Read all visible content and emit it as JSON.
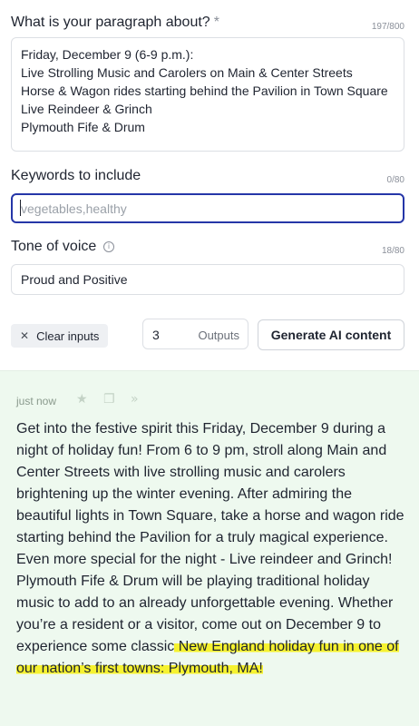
{
  "form": {
    "paragraph": {
      "label": "What is your paragraph about?",
      "required_mark": "*",
      "counter": "197/800",
      "lines": [
        "Friday, December 9 (6-9 p.m.):",
        "Live Strolling Music and Carolers on Main & Center Streets",
        "Horse & Wagon rides starting behind the Pavilion in Town Square",
        "Live Reindeer & Grinch",
        "Plymouth Fife & Drum"
      ]
    },
    "keywords": {
      "label": "Keywords to include",
      "counter": "0/80",
      "value": "",
      "placeholder": "vegetables,healthy"
    },
    "tone": {
      "label": "Tone of voice",
      "info_icon": "info-icon",
      "counter": "18/80",
      "value": "Proud and Positive"
    },
    "actions": {
      "clear_label": "Clear inputs",
      "outputs_value": "3",
      "outputs_label": "Outputs",
      "generate_label": "Generate AI content"
    }
  },
  "result": {
    "timestamp": "just now",
    "toolbar_icons": [
      "star-icon",
      "copy-icon",
      "double-chevron-right-icon"
    ],
    "text_plain": "Get into the festive spirit this Friday, December 9 during a night of holiday fun! From 6 to 9 pm, stroll along Main and Center Streets with live strolling music and carolers brightening up the winter evening. After admiring the beautiful lights in Town Square, take a horse and wagon ride starting behind the Pavilion for a truly magical experience. Even more special for the night - Live reindeer and Grinch! Plymouth Fife & Drum will be playing traditional holiday music to add to an already unforgettable evening. Whether you’re a resident or a visitor, come out on December 9 to experience some classic",
    "text_highlighted": " New England holiday fun in one of our nation’s first towns: Plymouth, MA!",
    "highlight_color": "#f6f230",
    "panel_color": "#eef9ef"
  },
  "colors": {
    "focus_border": "#2536a8",
    "text": "#1f2430",
    "muted": "#8a8f99"
  }
}
